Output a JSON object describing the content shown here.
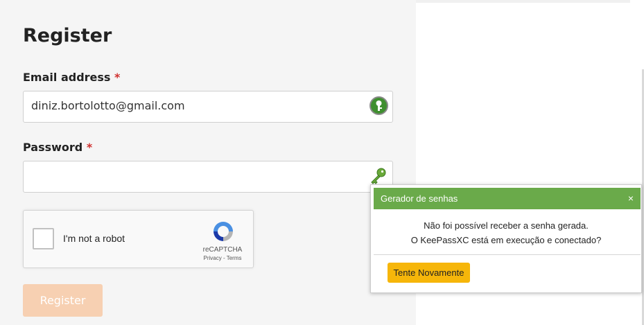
{
  "form": {
    "title": "Register",
    "email": {
      "label": "Email address",
      "required_mark": "*",
      "value": "diniz.bortolotto@gmail.com",
      "addon_icon": "keepassxc-logo-icon"
    },
    "password": {
      "label": "Password",
      "required_mark": "*",
      "value": "",
      "addon_icon": "key-icon"
    },
    "recaptcha": {
      "checkbox_label": "I'm not a robot",
      "brand": "reCAPTCHA",
      "privacy": "Privacy",
      "separator": "-",
      "terms": "Terms"
    },
    "submit_label": "Register"
  },
  "password_generator_popup": {
    "title": "Gerador de senhas",
    "close_symbol": "×",
    "message_line1": "Não foi possível receber a senha gerada.",
    "message_line2": "O KeePassXC está em execução e conectado?",
    "retry_label": "Tente Novamente"
  },
  "colors": {
    "required": "#d0302e",
    "popup_header": "#6aaa4a",
    "retry_button": "#f6b60a",
    "register_button_disabled": "#f7d0b2",
    "keepass_green": "#3f8f2f",
    "key_green": "#6aaa3a"
  }
}
